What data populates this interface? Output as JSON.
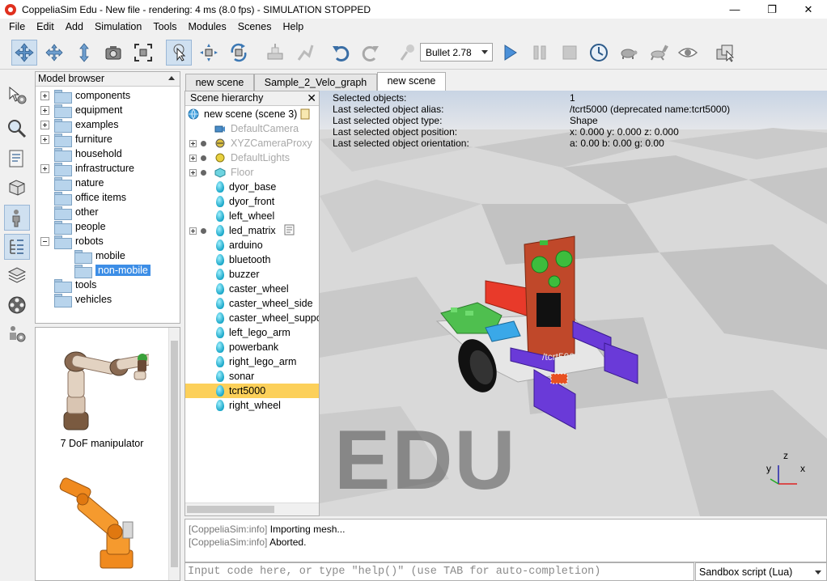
{
  "window": {
    "title": "CoppeliaSim Edu - New file - rendering: 4 ms (8.0 fps) - SIMULATION STOPPED",
    "minimize": "—",
    "maximize": "❐",
    "close": "✕"
  },
  "menu": [
    "File",
    "Edit",
    "Add",
    "Simulation",
    "Tools",
    "Modules",
    "Scenes",
    "Help"
  ],
  "toolbar": {
    "physics_engine": "Bullet 2.78",
    "icons": [
      "move-camera-icon",
      "rotate-camera-icon",
      "shift-camera-icon",
      "camera-view-icon",
      "fit-view-icon",
      "select-click-icon",
      "object-shift-icon",
      "object-rotate-icon",
      "assemble-icon",
      "transfer-dna-icon",
      "undo-icon",
      "redo-icon",
      "dynamic-content-icon",
      "play-icon",
      "pause-icon",
      "stop-icon",
      "realtime-icon",
      "slow-down-icon",
      "speed-up-icon",
      "thread-visualization-icon",
      "page-selector-icon"
    ]
  },
  "left_tools": [
    "simulation-settings-icon",
    "selection-icon",
    "scene-hierarchy-icon",
    "model-icon",
    "user-settings-icon",
    "hierarchy-toggle-icon",
    "layers-icon",
    "video-recorder-icon",
    "user-settings-2-icon"
  ],
  "model_browser": {
    "title": "Model browser",
    "items": [
      {
        "label": "components",
        "expander": "plus",
        "indent": 0
      },
      {
        "label": "equipment",
        "expander": "plus",
        "indent": 0
      },
      {
        "label": "examples",
        "expander": "plus",
        "indent": 0
      },
      {
        "label": "furniture",
        "expander": "plus",
        "indent": 0
      },
      {
        "label": "household",
        "expander": "none",
        "indent": 0
      },
      {
        "label": "infrastructure",
        "expander": "plus",
        "indent": 0
      },
      {
        "label": "nature",
        "expander": "none",
        "indent": 0
      },
      {
        "label": "office items",
        "expander": "none",
        "indent": 0
      },
      {
        "label": "other",
        "expander": "none",
        "indent": 0
      },
      {
        "label": "people",
        "expander": "none",
        "indent": 0
      },
      {
        "label": "robots",
        "expander": "minus",
        "indent": 0
      },
      {
        "label": "mobile",
        "expander": "none",
        "indent": 1
      },
      {
        "label": "non-mobile",
        "expander": "none",
        "indent": 1,
        "selected": true
      },
      {
        "label": "tools",
        "expander": "none",
        "indent": 0
      },
      {
        "label": "vehicles",
        "expander": "none",
        "indent": 0
      }
    ],
    "thumbnails": [
      {
        "label": "7 DoF manipulator"
      },
      {
        "label": ""
      }
    ]
  },
  "tabs": [
    {
      "label": "new scene",
      "active": false
    },
    {
      "label": "Sample_2_Velo_graph",
      "active": false
    },
    {
      "label": "new scene",
      "active": true
    }
  ],
  "hierarchy": {
    "title": "Scene hierarchy",
    "close": "✕",
    "root": "new scene (scene 3)",
    "items": [
      {
        "label": "DefaultCamera",
        "icon": "camera-icon",
        "dim": true
      },
      {
        "label": "XYZCameraProxy",
        "icon": "dummy-icon",
        "dim": true,
        "expander": true
      },
      {
        "label": "DefaultLights",
        "icon": "light-icon",
        "dim": true,
        "expander": true
      },
      {
        "label": "Floor",
        "icon": "floor-icon",
        "dim": true,
        "expander": true
      },
      {
        "label": "dyor_base",
        "icon": "shape-icon"
      },
      {
        "label": "dyor_front",
        "icon": "shape-icon"
      },
      {
        "label": "left_wheel",
        "icon": "shape-icon"
      },
      {
        "label": "led_matrix",
        "icon": "shape-icon",
        "expander": true,
        "script": true
      },
      {
        "label": "arduino",
        "icon": "shape-icon"
      },
      {
        "label": "bluetooth",
        "icon": "shape-icon"
      },
      {
        "label": "buzzer",
        "icon": "shape-icon"
      },
      {
        "label": "caster_wheel",
        "icon": "shape-icon"
      },
      {
        "label": "caster_wheel_side",
        "icon": "shape-icon"
      },
      {
        "label": "caster_wheel_support",
        "icon": "shape-icon"
      },
      {
        "label": "left_lego_arm",
        "icon": "shape-icon"
      },
      {
        "label": "powerbank",
        "icon": "shape-icon"
      },
      {
        "label": "right_lego_arm",
        "icon": "shape-icon"
      },
      {
        "label": "sonar",
        "icon": "shape-icon"
      },
      {
        "label": "tcrt5000",
        "icon": "shape-icon",
        "selected": true
      },
      {
        "label": "right_wheel",
        "icon": "shape-icon"
      }
    ]
  },
  "viewport": {
    "info": [
      {
        "label": "Selected objects:",
        "value": "1"
      },
      {
        "label": "Last selected object alias:",
        "value": "/tcrt5000   (deprecated name:tcrt5000)"
      },
      {
        "label": "Last selected object type:",
        "value": "Shape"
      },
      {
        "label": "Last selected object position:",
        "value": "x: 0.000    y: 0.000    z: 0.000"
      },
      {
        "label": "Last selected object orientation:",
        "value": "a: 0.00    b: 0.00    g: 0.00"
      }
    ],
    "object_label": "/tcrt5000",
    "watermark": "EDU",
    "axes": {
      "x": "x",
      "y": "y",
      "z": "z"
    }
  },
  "console": {
    "lines": [
      {
        "tag": "[CoppeliaSim:info]",
        "text": "Importing mesh..."
      },
      {
        "tag": "[CoppeliaSim:info]",
        "text": "Aborted."
      }
    ]
  },
  "command": {
    "placeholder": "Input code here, or type \"help()\" (use TAB for auto-completion)",
    "script_mode": "Sandbox script (Lua)"
  }
}
